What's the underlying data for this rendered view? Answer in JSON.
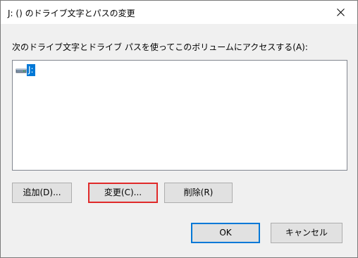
{
  "window": {
    "title": "J: () のドライブ文字とパスの変更"
  },
  "instruction": "次のドライブ文字とドライブ パスを使ってこのボリュームにアクセスする(A):",
  "drive_list": {
    "items": [
      {
        "label": "J:",
        "icon": "drive-icon",
        "selected": true
      }
    ]
  },
  "buttons": {
    "add": "追加(D)...",
    "change": "変更(C)...",
    "remove": "削除(R)",
    "ok": "OK",
    "cancel": "キャンセル"
  },
  "colors": {
    "selection": "#0078d7",
    "focus_highlight": "#e02a2a",
    "default_button_border": "#0078d7",
    "button_face": "#e1e1e1"
  }
}
